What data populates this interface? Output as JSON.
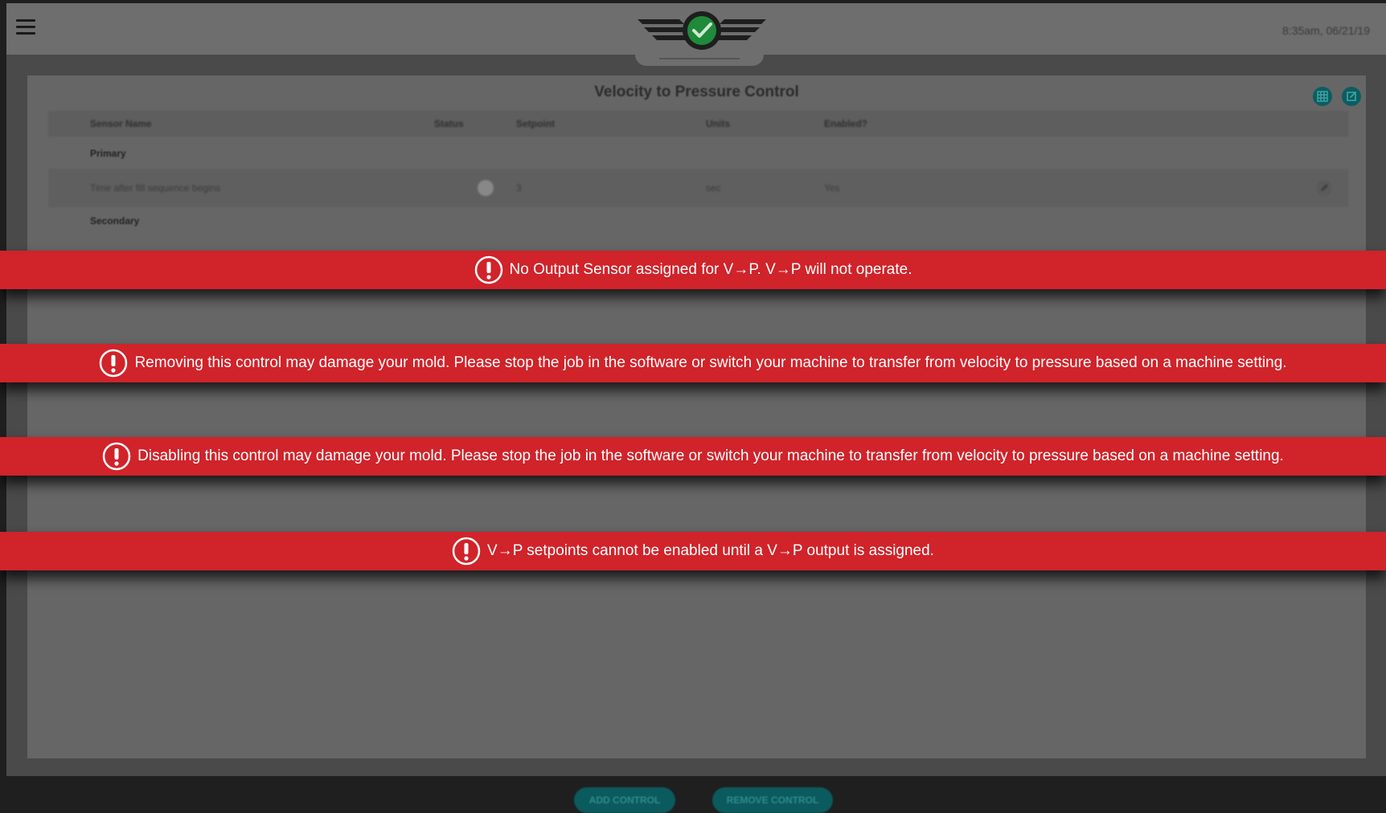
{
  "header": {
    "timestamp": "8:35am, 06/21/19",
    "menu_icon": "hamburger-icon",
    "logo_icon": "winged-checkmark-logo"
  },
  "panel": {
    "title": "Velocity to Pressure Control",
    "grid_icon": "grid-icon",
    "export_icon": "export-icon",
    "columns": [
      "Sensor Name",
      "Status",
      "Setpoint",
      "Units",
      "Enabled?"
    ],
    "groups": {
      "primary": "Primary",
      "secondary": "Secondary"
    },
    "rows": [
      {
        "sensor_name": "Time after fill sequence begins",
        "setpoint": "3",
        "units": "sec",
        "enabled": "Yes",
        "edit_icon": "pencil-icon"
      }
    ],
    "buttons": {
      "add": "ADD CONTROL",
      "remove": "REMOVE CONTROL"
    }
  },
  "alerts": [
    {
      "message": "No Output Sensor assigned for V→P. V→P will not operate.",
      "icon": "exclamation-circle-icon"
    },
    {
      "message": "Removing this control may damage your mold. Please stop the job in the software or switch your machine to transfer from velocity to pressure based on a machine setting.",
      "icon": "exclamation-circle-icon"
    },
    {
      "message": "Disabling this control may damage your mold. Please stop the job in the software or switch your machine to transfer from velocity to pressure based on a machine setting.",
      "icon": "exclamation-circle-icon"
    },
    {
      "message": "V→P setpoints cannot be enabled until a V→P output is assigned.",
      "icon": "exclamation-circle-icon"
    }
  ],
  "colors": {
    "alert_red": "#d0232a",
    "teal": "#0b5a5d",
    "logo_green": "#1f8a3a"
  }
}
